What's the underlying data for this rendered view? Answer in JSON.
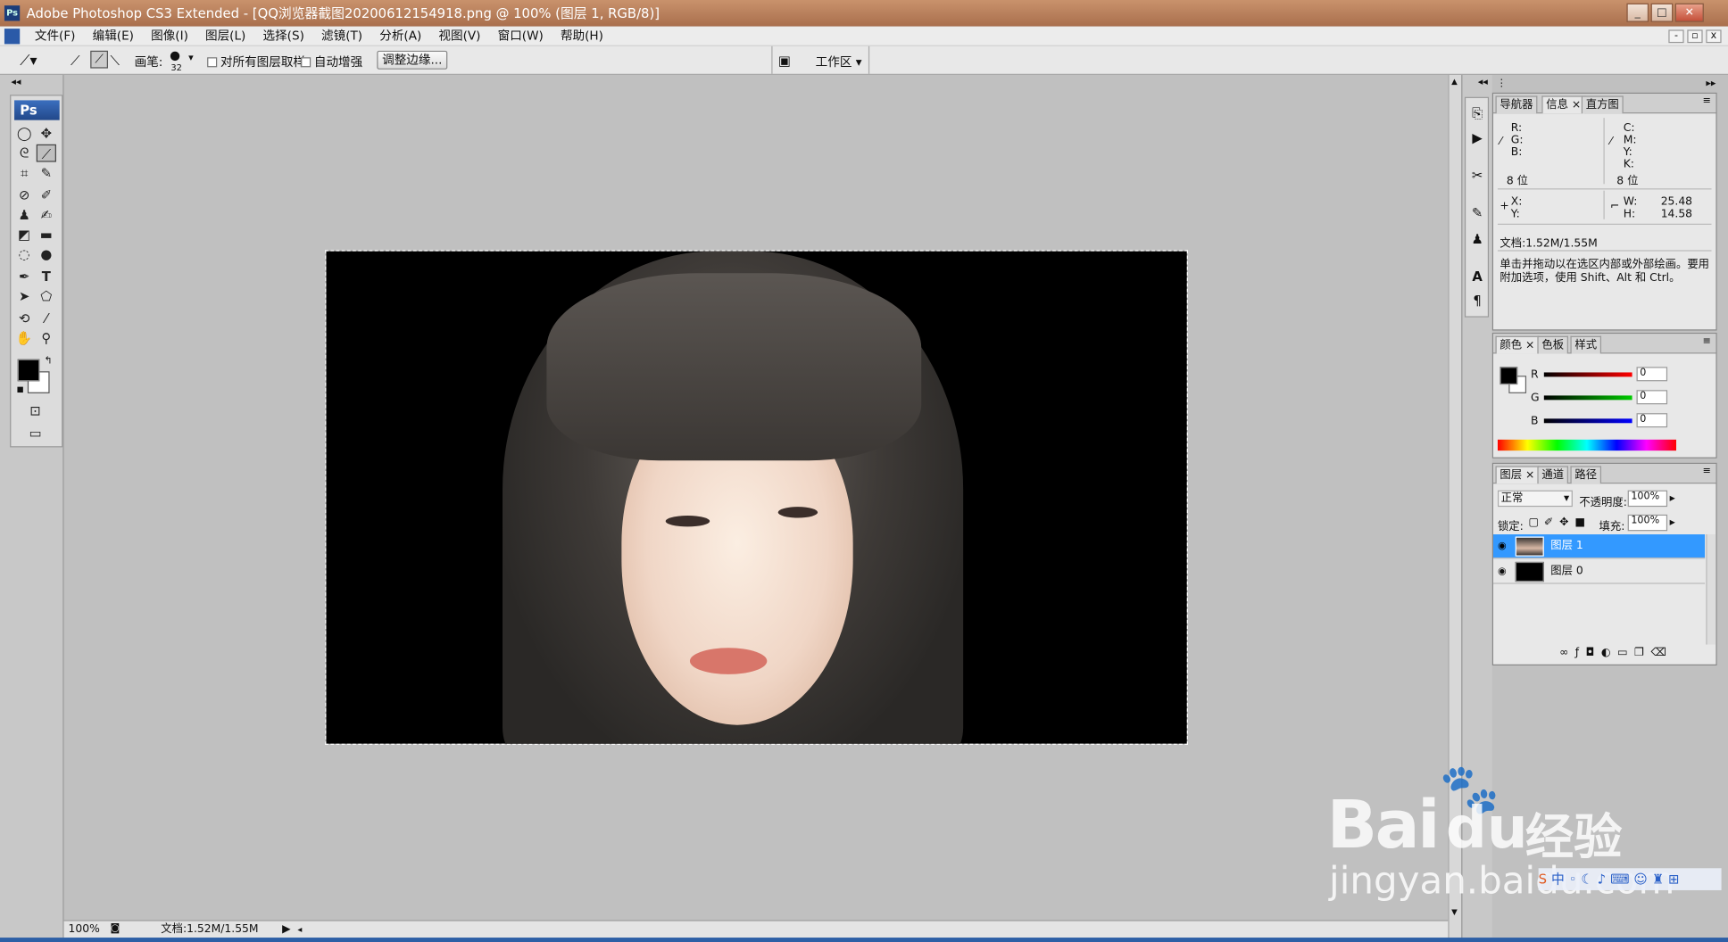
{
  "window": {
    "title": "Adobe Photoshop CS3 Extended - [QQ浏览器截图20200612154918.png @ 100% (图层 1, RGB/8)]",
    "icon": "ps-app-icon"
  },
  "menu": {
    "items": [
      "文件(F)",
      "编辑(E)",
      "图像(I)",
      "图层(L)",
      "选择(S)",
      "滤镜(T)",
      "分析(A)",
      "视图(V)",
      "窗口(W)",
      "帮助(H)"
    ]
  },
  "options": {
    "brush_label": "画笔:",
    "brush_size": "32",
    "sample_all_layers": "对所有图层取样",
    "auto_enhance": "自动增强",
    "refine_edge": "调整边缘...",
    "workspace": "工作区"
  },
  "toolbox": {
    "logo": "Ps"
  },
  "status": {
    "zoom": "100%",
    "doc_info": "文档:1.52M/1.55M"
  },
  "info_panel": {
    "tabs": [
      "导航器",
      "信息",
      "直方图"
    ],
    "r": "R:",
    "g": "G:",
    "b": "B:",
    "bits_left": "8 位",
    "c": "C:",
    "m": "M:",
    "y_cmyk": "Y:",
    "k": "K:",
    "bits_right": "8 位",
    "x": "X:",
    "y": "Y:",
    "w_label": "W:",
    "w_value": "25.48",
    "h_label": "H:",
    "h_value": "14.58",
    "doc": "文档:1.52M/1.55M",
    "hint": "单击并拖动以在选区内部或外部绘画。要用附加选项，使用 Shift、Alt 和 Ctrl。"
  },
  "color_panel": {
    "tabs": [
      "颜色",
      "色板",
      "样式"
    ],
    "r_label": "R",
    "g_label": "G",
    "b_label": "B",
    "r": "0",
    "g": "0",
    "b": "0"
  },
  "layers_panel": {
    "tabs": [
      "图层",
      "通道",
      "路径"
    ],
    "blend": "正常",
    "opacity_label": "不透明度:",
    "opacity": "100%",
    "lock_label": "锁定:",
    "fill_label": "填充:",
    "fill": "100%",
    "layers": [
      {
        "name": "图层 1",
        "selected": true
      },
      {
        "name": "图层 0",
        "selected": false
      }
    ]
  },
  "watermark": {
    "brand": "Bai",
    "du": "du",
    "cn": "经验",
    "url": "jingyan.baidu.com"
  },
  "colors": {
    "selected_layer": "#3399ff",
    "titlebar": "#b87c58"
  }
}
